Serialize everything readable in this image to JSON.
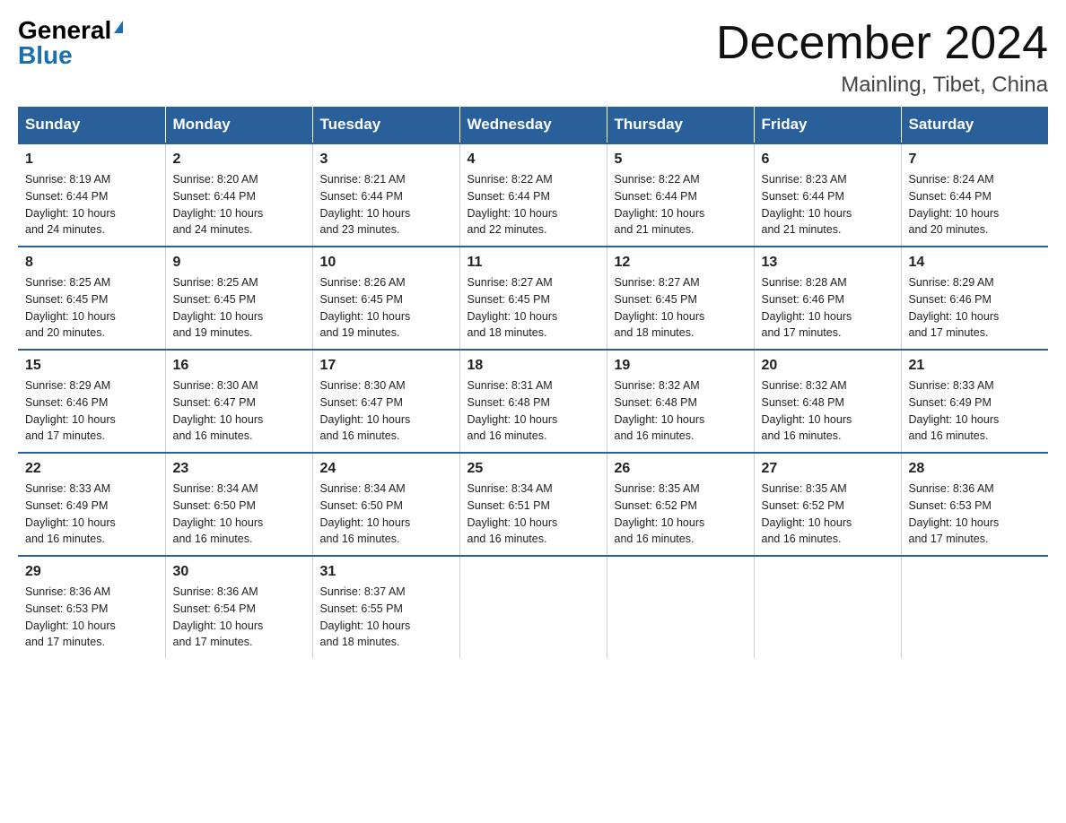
{
  "logo": {
    "general": "General",
    "blue": "Blue"
  },
  "title": {
    "month": "December 2024",
    "location": "Mainling, Tibet, China"
  },
  "headers": [
    "Sunday",
    "Monday",
    "Tuesday",
    "Wednesday",
    "Thursday",
    "Friday",
    "Saturday"
  ],
  "weeks": [
    [
      {
        "day": "1",
        "sunrise": "8:19 AM",
        "sunset": "6:44 PM",
        "daylight": "10 hours and 24 minutes."
      },
      {
        "day": "2",
        "sunrise": "8:20 AM",
        "sunset": "6:44 PM",
        "daylight": "10 hours and 24 minutes."
      },
      {
        "day": "3",
        "sunrise": "8:21 AM",
        "sunset": "6:44 PM",
        "daylight": "10 hours and 23 minutes."
      },
      {
        "day": "4",
        "sunrise": "8:22 AM",
        "sunset": "6:44 PM",
        "daylight": "10 hours and 22 minutes."
      },
      {
        "day": "5",
        "sunrise": "8:22 AM",
        "sunset": "6:44 PM",
        "daylight": "10 hours and 21 minutes."
      },
      {
        "day": "6",
        "sunrise": "8:23 AM",
        "sunset": "6:44 PM",
        "daylight": "10 hours and 21 minutes."
      },
      {
        "day": "7",
        "sunrise": "8:24 AM",
        "sunset": "6:44 PM",
        "daylight": "10 hours and 20 minutes."
      }
    ],
    [
      {
        "day": "8",
        "sunrise": "8:25 AM",
        "sunset": "6:45 PM",
        "daylight": "10 hours and 20 minutes."
      },
      {
        "day": "9",
        "sunrise": "8:25 AM",
        "sunset": "6:45 PM",
        "daylight": "10 hours and 19 minutes."
      },
      {
        "day": "10",
        "sunrise": "8:26 AM",
        "sunset": "6:45 PM",
        "daylight": "10 hours and 19 minutes."
      },
      {
        "day": "11",
        "sunrise": "8:27 AM",
        "sunset": "6:45 PM",
        "daylight": "10 hours and 18 minutes."
      },
      {
        "day": "12",
        "sunrise": "8:27 AM",
        "sunset": "6:45 PM",
        "daylight": "10 hours and 18 minutes."
      },
      {
        "day": "13",
        "sunrise": "8:28 AM",
        "sunset": "6:46 PM",
        "daylight": "10 hours and 17 minutes."
      },
      {
        "day": "14",
        "sunrise": "8:29 AM",
        "sunset": "6:46 PM",
        "daylight": "10 hours and 17 minutes."
      }
    ],
    [
      {
        "day": "15",
        "sunrise": "8:29 AM",
        "sunset": "6:46 PM",
        "daylight": "10 hours and 17 minutes."
      },
      {
        "day": "16",
        "sunrise": "8:30 AM",
        "sunset": "6:47 PM",
        "daylight": "10 hours and 16 minutes."
      },
      {
        "day": "17",
        "sunrise": "8:30 AM",
        "sunset": "6:47 PM",
        "daylight": "10 hours and 16 minutes."
      },
      {
        "day": "18",
        "sunrise": "8:31 AM",
        "sunset": "6:48 PM",
        "daylight": "10 hours and 16 minutes."
      },
      {
        "day": "19",
        "sunrise": "8:32 AM",
        "sunset": "6:48 PM",
        "daylight": "10 hours and 16 minutes."
      },
      {
        "day": "20",
        "sunrise": "8:32 AM",
        "sunset": "6:48 PM",
        "daylight": "10 hours and 16 minutes."
      },
      {
        "day": "21",
        "sunrise": "8:33 AM",
        "sunset": "6:49 PM",
        "daylight": "10 hours and 16 minutes."
      }
    ],
    [
      {
        "day": "22",
        "sunrise": "8:33 AM",
        "sunset": "6:49 PM",
        "daylight": "10 hours and 16 minutes."
      },
      {
        "day": "23",
        "sunrise": "8:34 AM",
        "sunset": "6:50 PM",
        "daylight": "10 hours and 16 minutes."
      },
      {
        "day": "24",
        "sunrise": "8:34 AM",
        "sunset": "6:50 PM",
        "daylight": "10 hours and 16 minutes."
      },
      {
        "day": "25",
        "sunrise": "8:34 AM",
        "sunset": "6:51 PM",
        "daylight": "10 hours and 16 minutes."
      },
      {
        "day": "26",
        "sunrise": "8:35 AM",
        "sunset": "6:52 PM",
        "daylight": "10 hours and 16 minutes."
      },
      {
        "day": "27",
        "sunrise": "8:35 AM",
        "sunset": "6:52 PM",
        "daylight": "10 hours and 16 minutes."
      },
      {
        "day": "28",
        "sunrise": "8:36 AM",
        "sunset": "6:53 PM",
        "daylight": "10 hours and 17 minutes."
      }
    ],
    [
      {
        "day": "29",
        "sunrise": "8:36 AM",
        "sunset": "6:53 PM",
        "daylight": "10 hours and 17 minutes."
      },
      {
        "day": "30",
        "sunrise": "8:36 AM",
        "sunset": "6:54 PM",
        "daylight": "10 hours and 17 minutes."
      },
      {
        "day": "31",
        "sunrise": "8:37 AM",
        "sunset": "6:55 PM",
        "daylight": "10 hours and 18 minutes."
      },
      null,
      null,
      null,
      null
    ]
  ],
  "labels": {
    "sunrise": "Sunrise:",
    "sunset": "Sunset:",
    "daylight": "Daylight:"
  }
}
